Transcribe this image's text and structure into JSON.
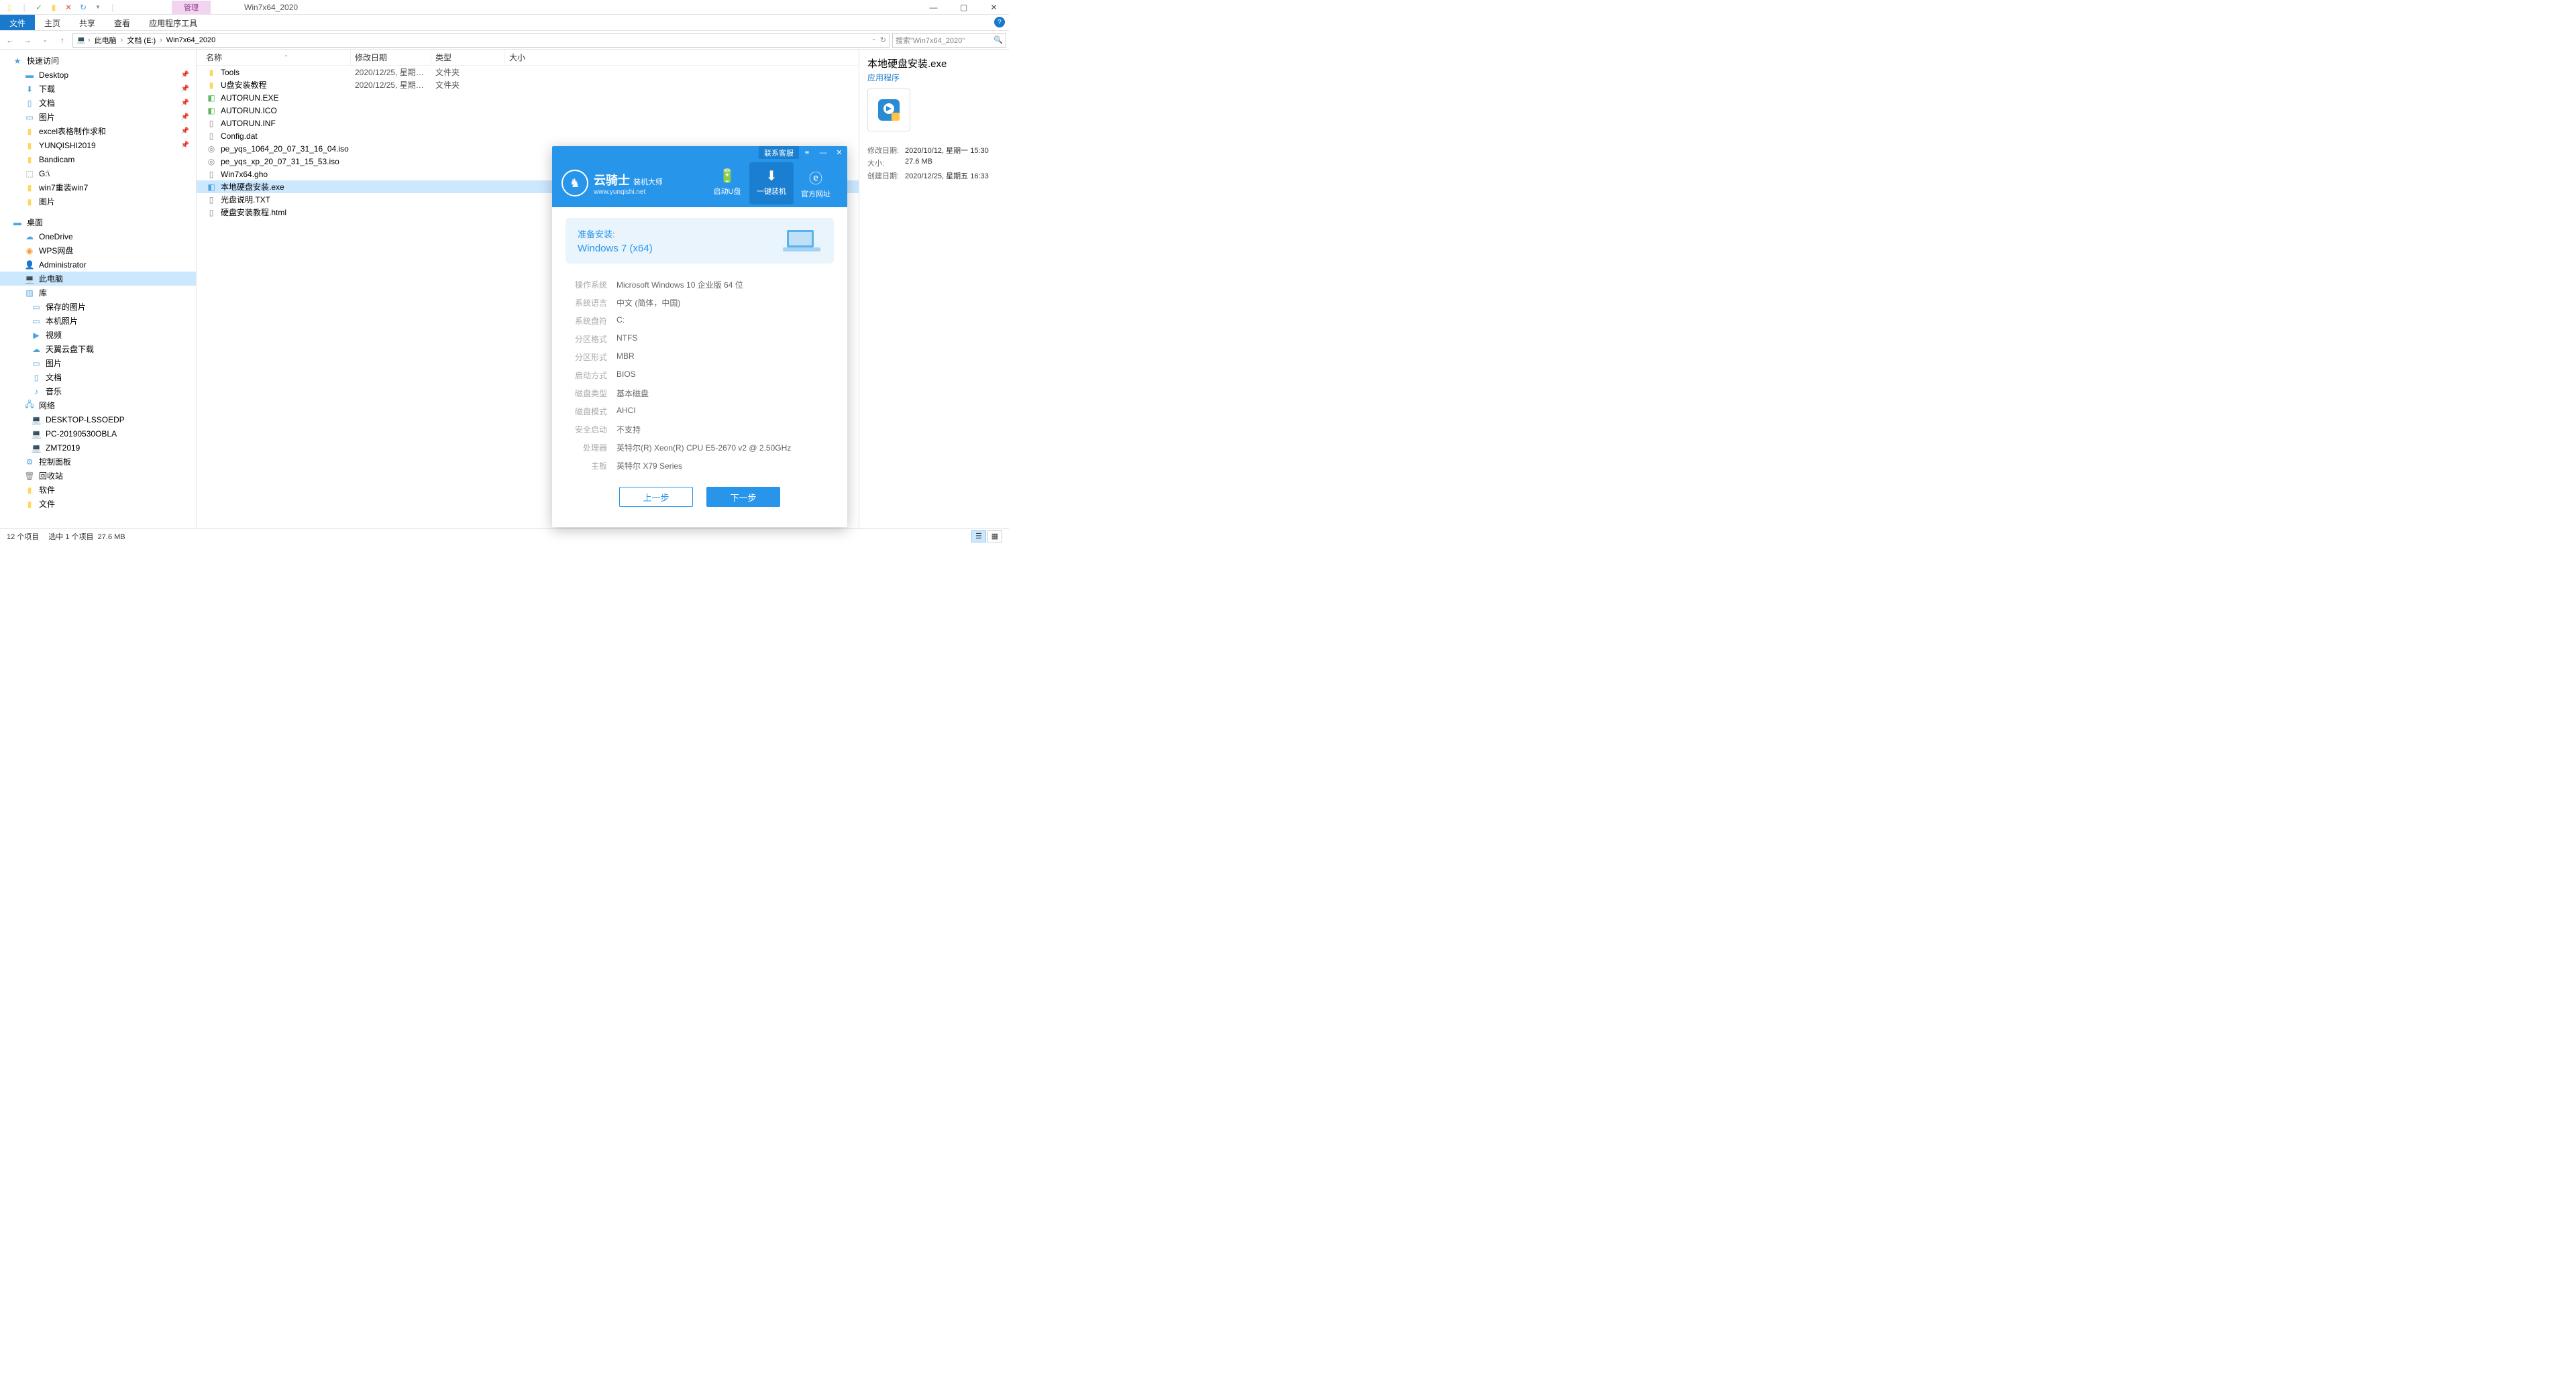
{
  "window": {
    "context_tab": "管理",
    "title": "Win7x64_2020"
  },
  "ribbon": {
    "file": "文件",
    "home": "主页",
    "share": "共享",
    "view": "查看",
    "app_tools": "应用程序工具"
  },
  "breadcrumb": {
    "this_pc": "此电脑",
    "docs": "文档 (E:)",
    "folder": "Win7x64_2020",
    "refresh_hint": ""
  },
  "search": {
    "placeholder": "搜索\"Win7x64_2020\""
  },
  "columns": {
    "name": "名称",
    "date": "修改日期",
    "type": "类型",
    "size": "大小"
  },
  "nav": {
    "quick_access": "快速访问",
    "desktop": "Desktop",
    "downloads": "下载",
    "docs": "文档",
    "pics": "图片",
    "excel": "excel表格制作求和",
    "yqs": "YUNQISHI2019",
    "bandicam": "Bandicam",
    "gdrive": "G:\\",
    "win7re": "win7重装win7",
    "pics2": "图片",
    "desktop2": "桌面",
    "onedrive": "OneDrive",
    "wps": "WPS网盘",
    "admin": "Administrator",
    "thispc": "此电脑",
    "libraries": "库",
    "saved_pics": "保存的图片",
    "cam_roll": "本机照片",
    "videos": "视频",
    "tianyi": "天翼云盘下载",
    "pics3": "图片",
    "docs2": "文档",
    "music": "音乐",
    "network": "网络",
    "pc1": "DESKTOP-LSSOEDP",
    "pc2": "PC-20190530OBLA",
    "pc3": "ZMT2019",
    "ctrlpanel": "控制面板",
    "recycle": "回收站",
    "software": "软件",
    "files": "文件"
  },
  "files": [
    {
      "name": "Tools",
      "date": "2020/12/25, 星期五 1...",
      "type": "文件夹",
      "icon": "folder"
    },
    {
      "name": "U盘安装教程",
      "date": "2020/12/25, 星期五 1...",
      "type": "文件夹",
      "icon": "folder"
    },
    {
      "name": "AUTORUN.EXE",
      "date": "",
      "type": "",
      "icon": "exe-green"
    },
    {
      "name": "AUTORUN.ICO",
      "date": "",
      "type": "",
      "icon": "ico"
    },
    {
      "name": "AUTORUN.INF",
      "date": "",
      "type": "",
      "icon": "inf"
    },
    {
      "name": "Config.dat",
      "date": "",
      "type": "",
      "icon": "dat"
    },
    {
      "name": "pe_yqs_1064_20_07_31_16_04.iso",
      "date": "",
      "type": "",
      "icon": "iso"
    },
    {
      "name": "pe_yqs_xp_20_07_31_15_53.iso",
      "date": "",
      "type": "",
      "icon": "iso"
    },
    {
      "name": "Win7x64.gho",
      "date": "",
      "type": "",
      "icon": "gho"
    },
    {
      "name": "本地硬盘安装.exe",
      "date": "",
      "type": "",
      "icon": "exe-blue",
      "selected": true
    },
    {
      "name": "光盘说明.TXT",
      "date": "",
      "type": "",
      "icon": "txt"
    },
    {
      "name": "硬盘安装教程.html",
      "date": "",
      "type": "",
      "icon": "html"
    }
  ],
  "details": {
    "title": "本地硬盘安装.exe",
    "type": "应用程序",
    "rows": [
      {
        "label": "修改日期:",
        "val": "2020/10/12, 星期一 15:30"
      },
      {
        "label": "大小:",
        "val": "27.6 MB"
      },
      {
        "label": "创建日期:",
        "val": "2020/12/25, 星期五 16:33"
      }
    ]
  },
  "status": {
    "items": "12 个项目",
    "selected": "选中 1 个项目",
    "size": "27.6 MB"
  },
  "yqs": {
    "contact": "联系客服",
    "brand_main": "云骑士",
    "brand_sub": "装机大师",
    "brand_url": "www.yunqishi.net",
    "nav_usb": "启动U盘",
    "nav_install": "一键装机",
    "nav_site": "官方网址",
    "prep_label": "准备安装:",
    "prep_os": "Windows 7 (x64)",
    "info": [
      {
        "label": "操作系统",
        "val": "Microsoft Windows 10 企业版 64 位"
      },
      {
        "label": "系统语言",
        "val": "中文 (简体，中国)"
      },
      {
        "label": "系统盘符",
        "val": "C:"
      },
      {
        "label": "分区格式",
        "val": "NTFS"
      },
      {
        "label": "分区形式",
        "val": "MBR"
      },
      {
        "label": "启动方式",
        "val": "BIOS"
      },
      {
        "label": "磁盘类型",
        "val": "基本磁盘"
      },
      {
        "label": "磁盘模式",
        "val": "AHCI"
      },
      {
        "label": "安全启动",
        "val": "不支持"
      },
      {
        "label": "处理器",
        "val": "英特尔(R) Xeon(R) CPU E5-2670 v2 @ 2.50GHz"
      },
      {
        "label": "主板",
        "val": "英特尔 X79 Series"
      }
    ],
    "btn_prev": "上一步",
    "btn_next": "下一步"
  }
}
